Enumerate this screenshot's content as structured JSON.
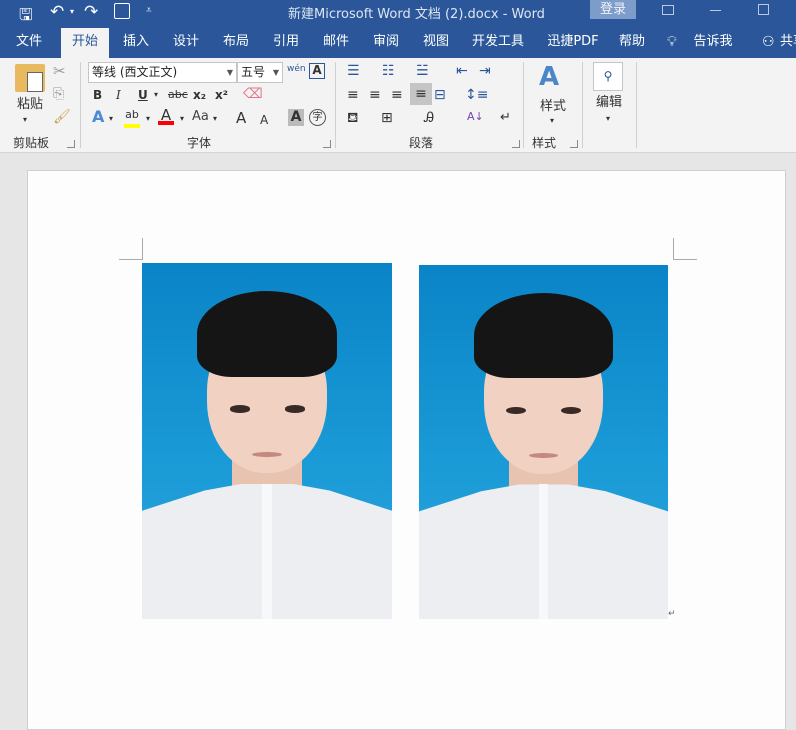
{
  "titlebar": {
    "title": "新建Microsoft Word 文档 (2).docx  -  Word",
    "login": "登录"
  },
  "tabs": [
    {
      "label": "文件"
    },
    {
      "label": "开始"
    },
    {
      "label": "插入"
    },
    {
      "label": "设计"
    },
    {
      "label": "布局"
    },
    {
      "label": "引用"
    },
    {
      "label": "邮件"
    },
    {
      "label": "审阅"
    },
    {
      "label": "视图"
    },
    {
      "label": "开发工具"
    },
    {
      "label": "迅捷PDF"
    },
    {
      "label": "帮助"
    }
  ],
  "tell_me": "告诉我",
  "share": "共享",
  "ribbon": {
    "clipboard": {
      "paste": "粘贴",
      "label": "剪贴板"
    },
    "font": {
      "name": "等线 (西文正文)",
      "size": "五号",
      "label": "字体",
      "bold": "B",
      "italic": "I",
      "underline": "U",
      "strike": "abc",
      "sub": "x₂",
      "sup": "x²",
      "case": "Aa",
      "phonetic": "wén",
      "char_border": "A",
      "grow": "A",
      "shrink": "A",
      "shade": "A",
      "enclose": "字"
    },
    "paragraph": {
      "label": "段落"
    },
    "styles": {
      "button": "样式",
      "label": "样式"
    },
    "editing": {
      "button": "编辑"
    }
  },
  "colors": {
    "brand": "#2b579a",
    "highlight": "#ffff00",
    "font_color": "#ff0000"
  }
}
